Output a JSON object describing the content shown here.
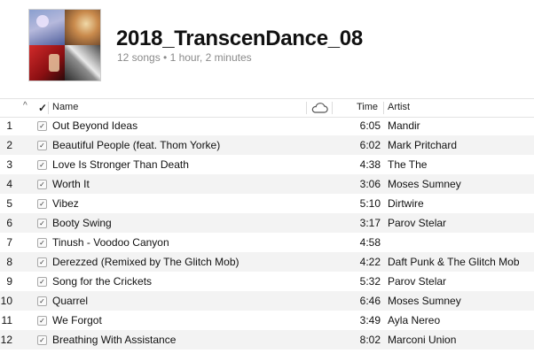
{
  "playlist": {
    "title": "2018_TranscenDance_08",
    "subtitle": "12 songs • 1 hour, 2 minutes"
  },
  "columns": {
    "sort_indicator": "^",
    "check": "✓",
    "name": "Name",
    "cloud_icon": "cloud-icon",
    "time": "Time",
    "artist": "Artist"
  },
  "checkbox_mark": "✓",
  "tracks": [
    {
      "num": "1",
      "name": "Out Beyond Ideas",
      "time": "6:05",
      "artist": "Mandir"
    },
    {
      "num": "2",
      "name": "Beautiful People (feat. Thom Yorke)",
      "time": "6:02",
      "artist": "Mark Pritchard"
    },
    {
      "num": "3",
      "name": "Love Is Stronger Than Death",
      "time": "4:38",
      "artist": "The The"
    },
    {
      "num": "4",
      "name": "Worth It",
      "time": "3:06",
      "artist": "Moses Sumney"
    },
    {
      "num": "5",
      "name": "Vibez",
      "time": "5:10",
      "artist": "Dirtwire"
    },
    {
      "num": "6",
      "name": "Booty Swing",
      "time": "3:17",
      "artist": "Parov Stelar"
    },
    {
      "num": "7",
      "name": "Tinush - Voodoo Canyon",
      "time": "4:58",
      "artist": ""
    },
    {
      "num": "8",
      "name": "Derezzed (Remixed by The Glitch Mob)",
      "time": "4:22",
      "artist": "Daft Punk & The Glitch Mob"
    },
    {
      "num": "9",
      "name": "Song for the Crickets",
      "time": "5:32",
      "artist": "Parov Stelar"
    },
    {
      "num": "10",
      "name": "Quarrel",
      "time": "6:46",
      "artist": "Moses Sumney"
    },
    {
      "num": "11",
      "name": "We Forgot",
      "time": "3:49",
      "artist": "Ayla Nereo"
    },
    {
      "num": "12",
      "name": "Breathing With Assistance",
      "time": "8:02",
      "artist": "Marconi Union"
    }
  ]
}
